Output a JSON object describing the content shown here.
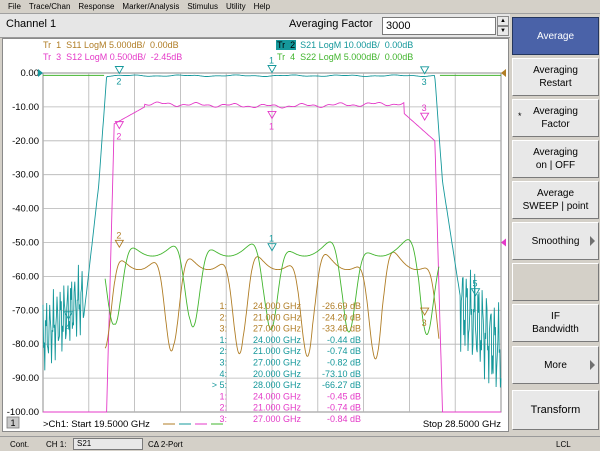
{
  "menu": [
    "File",
    "Trace/Chan",
    "Response",
    "Marker/Analysis",
    "Stimulus",
    "Utility",
    "Help"
  ],
  "channel_title": "Channel 1",
  "averaging": {
    "label": "Averaging Factor",
    "value": "3000"
  },
  "spin_up": "▲",
  "spin_down": "▼",
  "trace_labels": [
    {
      "text": "Tr  1  S11 LogM 5.000dB/  0.00dB",
      "color": "#b07d25"
    },
    {
      "text": "Tr  2  S21 LogM 10.00dB/  0.00dB",
      "color": "#15989b",
      "highlighted": true
    },
    {
      "text": "Tr  3  S12 LogM 0.500dB/  -2.45dB",
      "color": "#e43ac8"
    },
    {
      "text": "Tr  4  S22 LogM 5.000dB/  0.00dB",
      "color": "#42b52e"
    }
  ],
  "y_ticks": [
    "0.00",
    "-10.00",
    "-20.00",
    "-30.00",
    "-40.00",
    "-50.00",
    "-60.00",
    "-70.00",
    "-80.00",
    "-90.00",
    "-100.00"
  ],
  "stimulus": {
    "start": ">Ch1: Start  19.5000 GHz",
    "stop": "Stop  28.5000 GHz",
    "channel_badge": "1"
  },
  "marker_table": [
    {
      "id": "1:",
      "freq": "24.000 GHz",
      "value": "-26.69 dB",
      "color": "#b07d25"
    },
    {
      "id": "2:",
      "freq": "21.000 GHz",
      "value": "-24.20 dB",
      "color": "#b07d25"
    },
    {
      "id": "3:",
      "freq": "27.000 GHz",
      "value": "-33.48 dB",
      "color": "#b07d25"
    },
    {
      "id": "1:",
      "freq": "24.000 GHz",
      "value": "-0.44 dB",
      "color": "#15989b"
    },
    {
      "id": "2:",
      "freq": "21.000 GHz",
      "value": "-0.74 dB",
      "color": "#15989b"
    },
    {
      "id": "3:",
      "freq": "27.000 GHz",
      "value": "-0.82 dB",
      "color": "#15989b"
    },
    {
      "id": "4:",
      "freq": "20.000 GHz",
      "value": "-73.10 dB",
      "color": "#15989b"
    },
    {
      "id": "> 5:",
      "freq": "28.000 GHz",
      "value": "-66.27 dB",
      "color": "#15989b"
    },
    {
      "id": "1:",
      "freq": "24.000 GHz",
      "value": "-0.45 dB",
      "color": "#e43ac8"
    },
    {
      "id": "2:",
      "freq": "21.000 GHz",
      "value": "-0.74 dB",
      "color": "#e43ac8"
    },
    {
      "id": "3:",
      "freq": "27.000 GHz",
      "value": "-0.84 dB",
      "color": "#e43ac8"
    }
  ],
  "softkeys": [
    {
      "label": "Average",
      "active": true
    },
    {
      "label": "Averaging\nRestart"
    },
    {
      "label": "Averaging\nFactor",
      "star": "*"
    },
    {
      "label": "Averaging\non | OFF"
    },
    {
      "label": "Average\nSWEEP | point"
    },
    {
      "label": "Smoothing",
      "arrow": true
    },
    {
      "label": "",
      "blank": true
    },
    {
      "label": "IF\nBandwidth"
    },
    {
      "label": "More",
      "arrow": true
    },
    {
      "label": "",
      "blank": true
    },
    {
      "label": "Transform"
    }
  ],
  "status": {
    "cont": "Cont.",
    "channel": "CH 1:",
    "param": "S21",
    "cal": "CΔ 2-Port",
    "lcl": "LCL"
  }
}
